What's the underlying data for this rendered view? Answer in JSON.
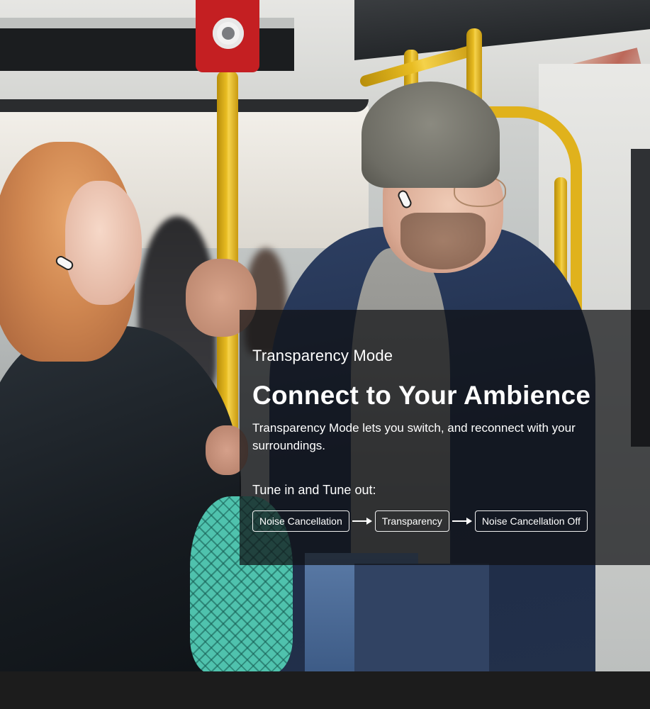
{
  "feature": {
    "mode_title": "Transparency Mode",
    "headline": "Connect to Your Ambience",
    "description": "Transparency Mode lets you switch, and reconnect with your surroundings.",
    "tune_label": "Tune in and Tune out:",
    "modes": [
      {
        "label": "Noise Cancellation"
      },
      {
        "label": "Transparency"
      },
      {
        "label": "Noise Cancellation Off"
      }
    ]
  },
  "colors": {
    "overlay": "#0f1114",
    "text": "#ffffff",
    "bottom_bar": "#1c1c1c"
  },
  "icons": {
    "flow_arrow": "arrow-right-icon"
  }
}
